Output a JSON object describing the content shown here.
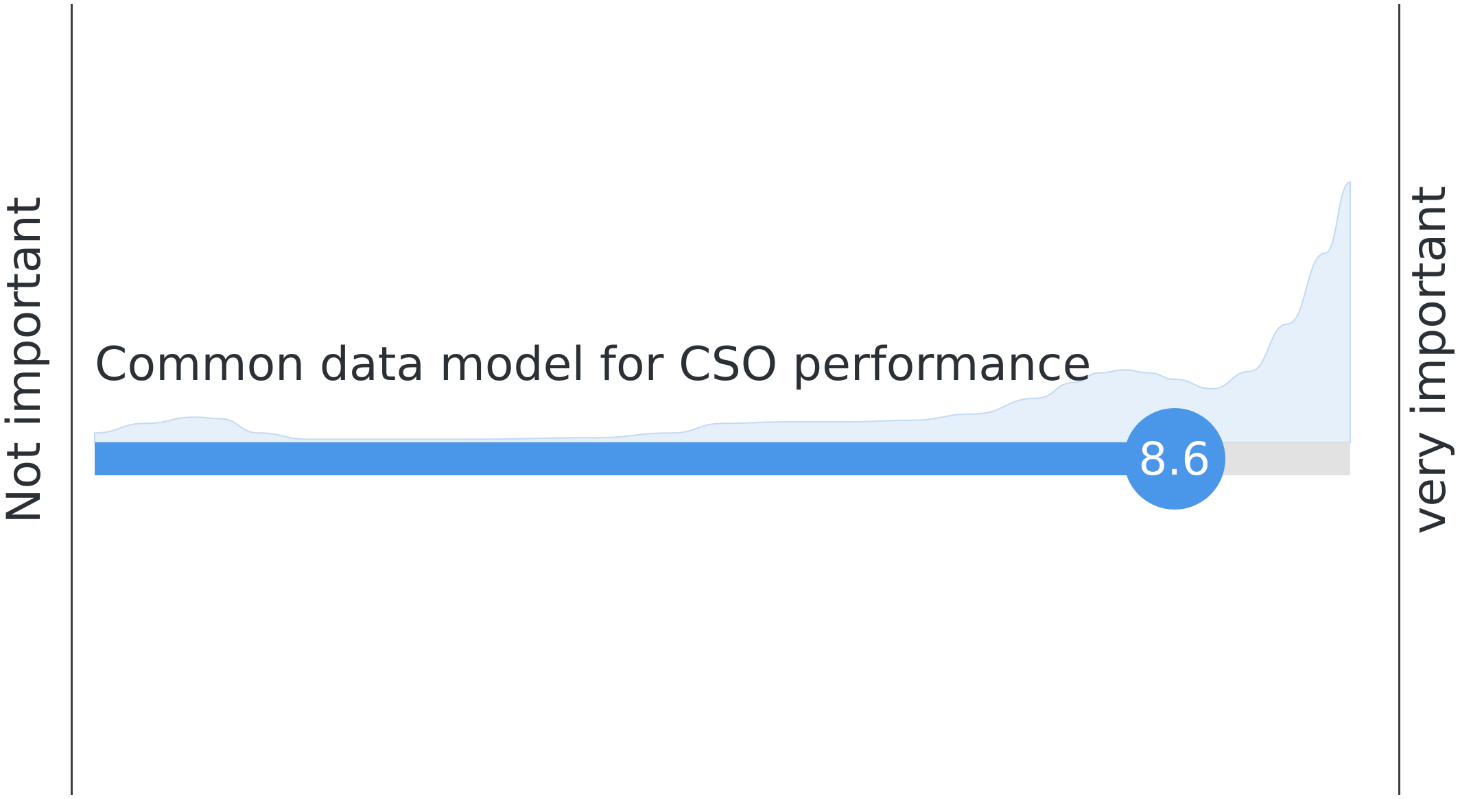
{
  "labels": {
    "left": "Not important",
    "right": "very important"
  },
  "colors": {
    "bar_fill": "#4a97ea",
    "bar_track": "#e2e2e2",
    "distribution_fill": "#e6f0fb",
    "distribution_stroke": "#c3d9f3",
    "axis_line": "#3a3d42"
  },
  "chart_data": {
    "type": "area",
    "title": "Common data model for CSO performance",
    "xlim": [
      0,
      10
    ],
    "value": 8.6,
    "value_label": "8.6",
    "distribution": {
      "x": [
        0,
        0.4,
        0.8,
        1.0,
        1.3,
        1.7,
        2.2,
        3.0,
        4.0,
        4.6,
        5.0,
        5.5,
        6.0,
        6.5,
        7.0,
        7.5,
        7.8,
        8.0,
        8.2,
        8.4,
        8.6,
        8.9,
        9.2,
        9.5,
        9.8,
        10.0
      ],
      "y": [
        0.06,
        0.12,
        0.16,
        0.15,
        0.06,
        0.02,
        0.02,
        0.02,
        0.03,
        0.06,
        0.12,
        0.13,
        0.13,
        0.14,
        0.18,
        0.28,
        0.38,
        0.44,
        0.46,
        0.44,
        0.4,
        0.34,
        0.45,
        0.75,
        1.2,
        1.65
      ]
    }
  }
}
